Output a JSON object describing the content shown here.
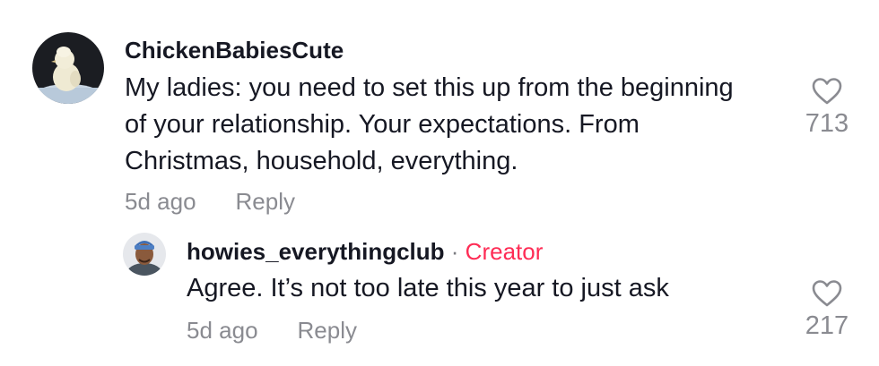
{
  "comments": [
    {
      "username": "ChickenBabiesCute",
      "text": "My ladies: you need to set this up from the beginning of your relationship. Your expectations. From Christmas, household, everything.",
      "time": "5d ago",
      "reply_label": "Reply",
      "like_count": "713",
      "like_icon": "heart-outline-icon"
    }
  ],
  "replies": [
    {
      "username": "howies_everythingclub",
      "separator": "·",
      "badge": "Creator",
      "text": "Agree. It’s not too late this year to just ask",
      "time": "5d ago",
      "reply_label": "Reply",
      "like_count": "217",
      "like_icon": "heart-outline-icon"
    }
  ],
  "colors": {
    "text": "#161823",
    "meta": "#8a8b91",
    "creator": "#fe2c55"
  }
}
